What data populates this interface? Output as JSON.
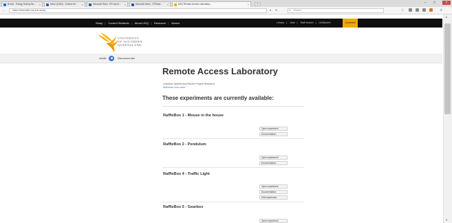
{
  "browser": {
    "tabs": [
      {
        "label": "Bonds - Energy Saving Sto...",
        "icon_color": "#1f6fce"
      },
      {
        "label": "Inbox (4,563) - Outlook W...",
        "icon_color": "#2a64c4"
      },
      {
        "label": "Microsoft Word - ER report...",
        "icon_color": "#2b5797"
      },
      {
        "label": "Microsoft Word - VSTeam...",
        "icon_color": "#2b5797"
      },
      {
        "label": "USQ Remote Access Laboratory...",
        "icon_color": "#f2a900"
      }
    ],
    "active_tab": 4,
    "url": "https://www.rallie.usq.edu.au/rig",
    "search_placeholder": "Search",
    "window_controls": {
      "minimize": "–",
      "maximize": "□",
      "close": "×"
    }
  },
  "site_nav": {
    "items": [
      "Study",
      "Current Students",
      "About USQ",
      "Research",
      "Alumni"
    ],
    "separator": "|",
    "right_items": [
      "Library",
      "Jobs",
      "Staff search",
      "UniSphere"
    ],
    "highlight_item": "UConnect",
    "highlight_color": "#f2a900"
  },
  "logo": {
    "line1": "UNIVERSITY",
    "line2": "OF SOUTHERN",
    "line3": "QUEENSLAND",
    "color": "#f2a900"
  },
  "user_bar": {
    "username": "u0w8e",
    "link": "Disconnect rate"
  },
  "main": {
    "title": "Remote Access Laboratory",
    "subtitle": "Univision System and RALfie Project Research",
    "auth_link": "Authorise new robot",
    "heading": "These experiments are currently available:",
    "experiments": [
      {
        "name": "RaffleBox 1 - Mouse in the house",
        "buttons": [
          "Open experiment",
          "Documentation"
        ]
      },
      {
        "name": "RaffleBox 2 - Pendulum",
        "buttons": [
          "Open experiment",
          "Documentation"
        ]
      },
      {
        "name": "RaffleBox 4 - Traffic Light",
        "buttons": [
          "Open experiment",
          "Documentation",
          "Edit experiment"
        ]
      },
      {
        "name": "RaffleBox 5 - Gearbox",
        "buttons": [
          "Open experiment"
        ]
      }
    ]
  }
}
